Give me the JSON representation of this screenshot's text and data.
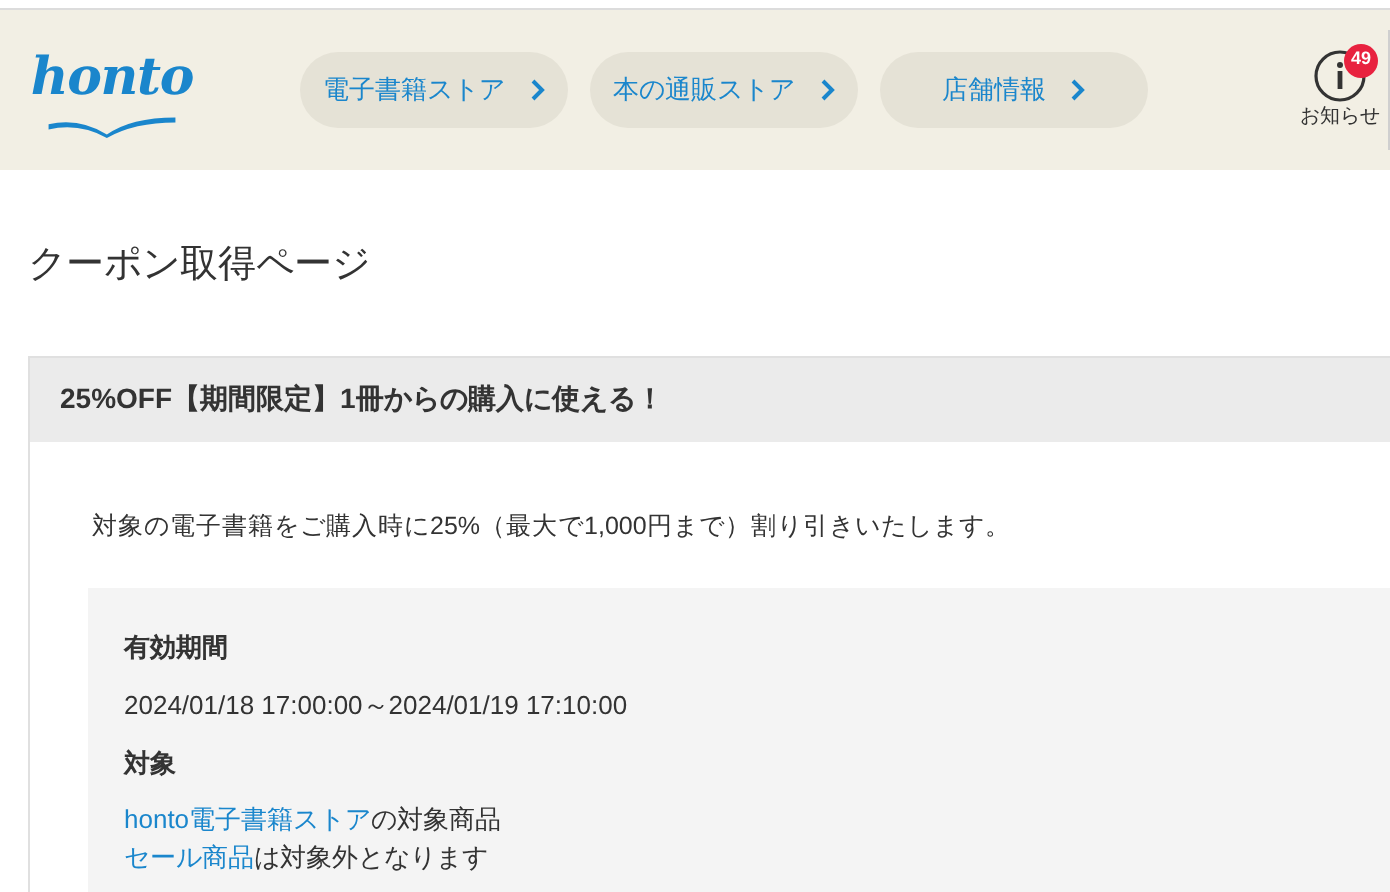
{
  "header": {
    "logo": "honto",
    "nav": [
      {
        "label": "電子書籍ストア"
      },
      {
        "label": "本の通販ストア"
      },
      {
        "label": "店舗情報"
      }
    ],
    "notice": {
      "label": "お知らせ",
      "count": "49"
    }
  },
  "page_title": "クーポン取得ページ",
  "coupon": {
    "title": "25%OFF【期間限定】1冊からの購入に使える！",
    "description": "対象の電子書籍をご購入時に25%（最大で1,000円まで）割り引きいたします。",
    "details": [
      {
        "heading": "有効期間",
        "lines": [
          {
            "text": "2024/01/18 17:00:00～2024/01/19 17:10:00"
          }
        ]
      },
      {
        "heading": "対象",
        "lines": [
          {
            "link": "honto電子書籍ストア",
            "text": "の対象商品"
          },
          {
            "link": "セール商品",
            "text": "は対象外となります"
          }
        ]
      }
    ]
  }
}
